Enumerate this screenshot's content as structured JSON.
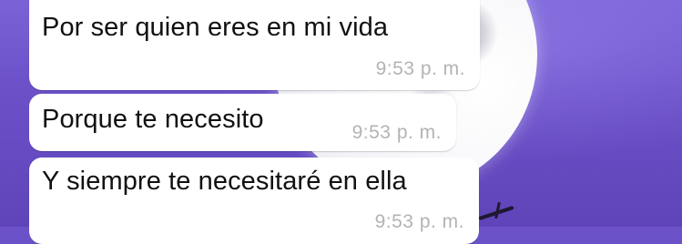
{
  "messages": [
    {
      "text": "Por ser quien eres en mi vida",
      "time": "9:53 p. m."
    },
    {
      "text": "Porque te necesito",
      "time": "9:53 p. m."
    },
    {
      "text": "Y siempre te necesitaré en ella",
      "time": "9:53 p. m."
    }
  ],
  "colors": {
    "bubble": "#ffffff",
    "timestamp": "#b3b3b3",
    "wallpaper": "#6c52c8"
  }
}
